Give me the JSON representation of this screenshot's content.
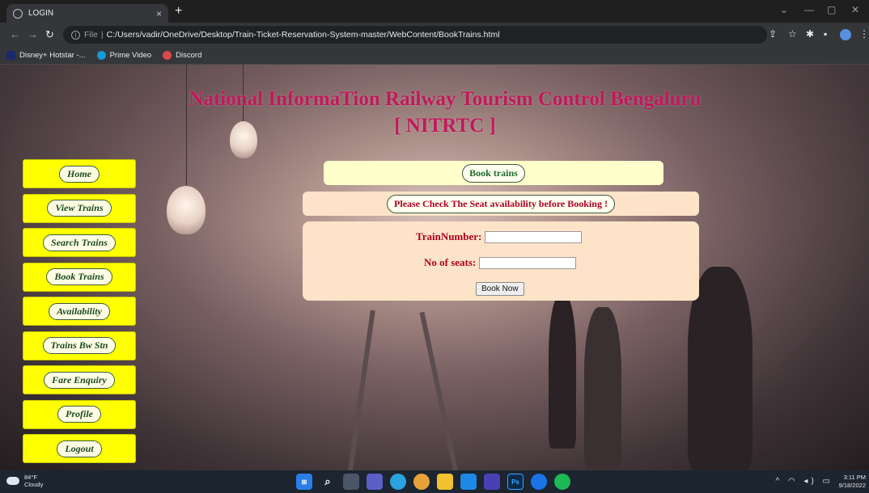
{
  "browser": {
    "tab_title": "LOGIN",
    "tab_close": "×",
    "new_tab": "+",
    "address_prefix": "File",
    "address_path": "C:/Users/vadir/OneDrive/Desktop/Train-Ticket-Reservation-System-master/WebContent/BookTrains.html",
    "bookmarks": [
      {
        "label": "Disney+ Hotstar -...",
        "color": "#1a2a6c"
      },
      {
        "label": "Prime Video",
        "color": "#1399d6"
      },
      {
        "label": "Discord",
        "color": "#d84b4b"
      }
    ],
    "window_controls": {
      "min": "—",
      "max": "▢",
      "close": "✕",
      "chev": "⌄"
    }
  },
  "page": {
    "heading_line1": "National InformaTion Railway Tourism Control Bengaluru",
    "heading_line2": "[ NITRTC ]",
    "sidebar": [
      {
        "label": "Home"
      },
      {
        "label": "View Trains"
      },
      {
        "label": "Search Trains"
      },
      {
        "label": "Book Trains"
      },
      {
        "label": "Availability"
      },
      {
        "label": "Trains Bw Stn"
      },
      {
        "label": "Fare Enquiry"
      },
      {
        "label": "Profile"
      },
      {
        "label": "Logout"
      }
    ],
    "section_title": "Book trains",
    "notice": "Please Check The Seat availability before Booking !",
    "form": {
      "train_number_label": "TrainNumber:",
      "train_number_value": "",
      "seats_label": "No of seats:",
      "seats_value": "",
      "submit_label": "Book Now"
    }
  },
  "taskbar": {
    "weather_temp": "84°F",
    "weather_desc": "Cloudy",
    "time": "3:11 PM",
    "date": "9/18/2022"
  }
}
